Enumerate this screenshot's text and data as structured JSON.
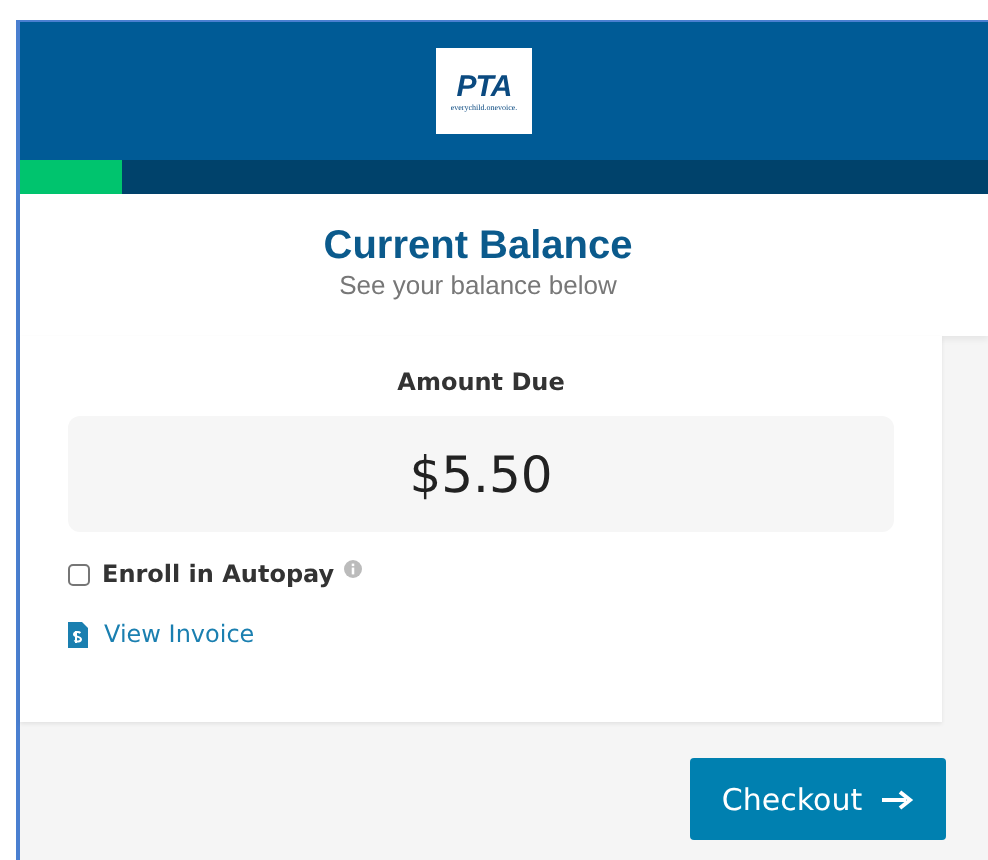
{
  "header": {
    "logo": {
      "name": "PTA",
      "tagline": "everychild.onevoice."
    }
  },
  "progress": {
    "level": 0.105
  },
  "title": {
    "heading": "Current Balance",
    "subtitle": "See your balance below"
  },
  "balance": {
    "label": "Amount Due",
    "amount": "$5.50"
  },
  "autopay": {
    "label": "Enroll in Autopay",
    "checked": false
  },
  "invoice_link": "View Invoice",
  "checkout_button": "Checkout"
}
